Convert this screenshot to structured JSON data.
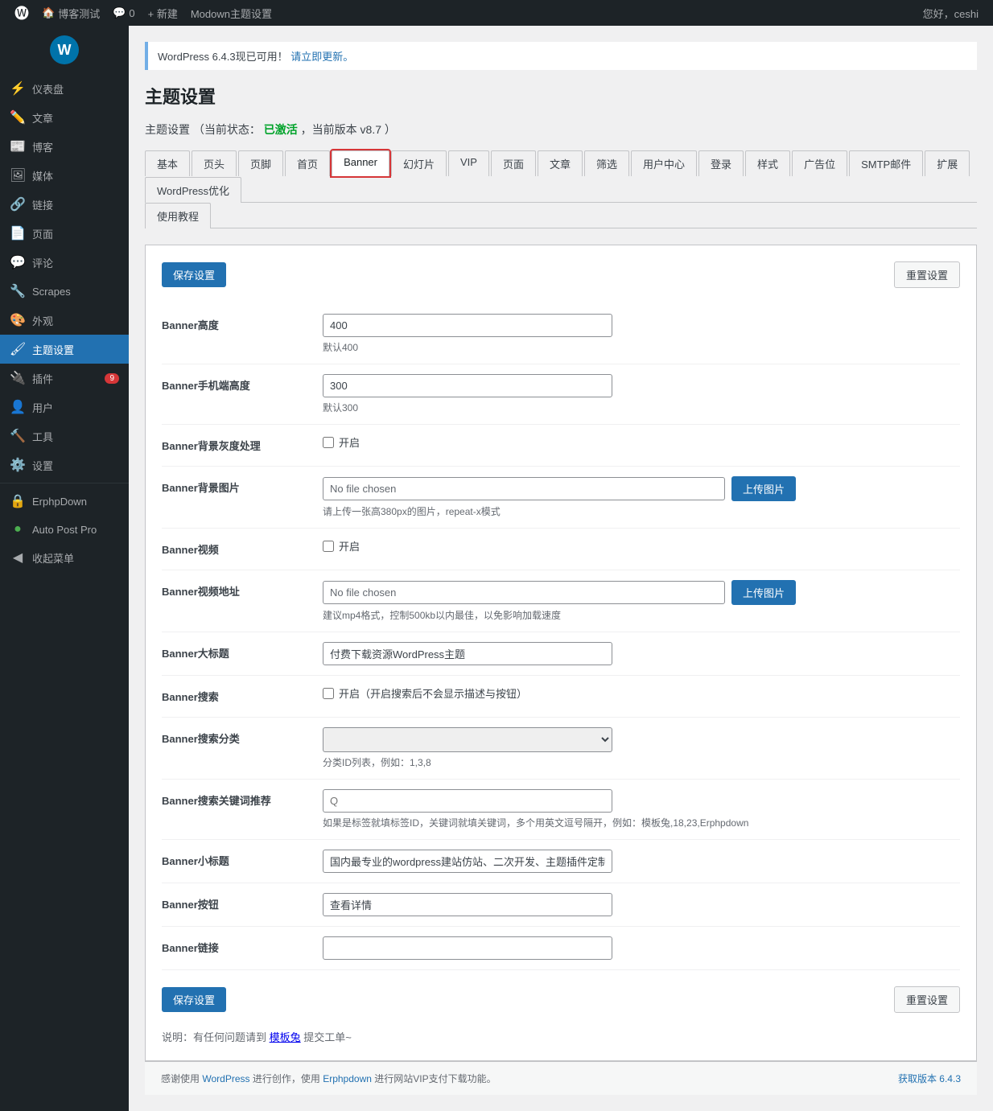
{
  "adminbar": {
    "site_name": "博客测试",
    "comment_count": "0",
    "new_label": "+ 新建",
    "page_title_bar": "Modown主题设置",
    "user_greeting": "您好，ceshi"
  },
  "sidebar": {
    "items": [
      {
        "id": "dashboard",
        "label": "仪表盘",
        "icon": "⚡"
      },
      {
        "id": "posts",
        "label": "文章",
        "icon": "✏️"
      },
      {
        "id": "blog",
        "label": "博客",
        "icon": "📰"
      },
      {
        "id": "media",
        "label": "媒体",
        "icon": "🖼"
      },
      {
        "id": "links",
        "label": "链接",
        "icon": "🔗"
      },
      {
        "id": "pages",
        "label": "页面",
        "icon": "📄"
      },
      {
        "id": "comments",
        "label": "评论",
        "icon": "💬"
      },
      {
        "id": "scrapes",
        "label": "Scrapes",
        "icon": "🔧"
      },
      {
        "id": "appearance",
        "label": "外观",
        "icon": "🎨"
      },
      {
        "id": "theme-settings",
        "label": "主题设置",
        "icon": "🖌",
        "active": true
      },
      {
        "id": "plugins",
        "label": "插件",
        "icon": "🔌",
        "badge": "9"
      },
      {
        "id": "users",
        "label": "用户",
        "icon": "👤"
      },
      {
        "id": "tools",
        "label": "工具",
        "icon": "🔨"
      },
      {
        "id": "settings",
        "label": "设置",
        "icon": "⚙️"
      },
      {
        "id": "erphpdown",
        "label": "ErphpDown",
        "icon": "🔒"
      },
      {
        "id": "autopostpro",
        "label": "Auto Post Pro",
        "icon": "●"
      },
      {
        "id": "cart",
        "label": "收起菜单",
        "icon": "◀"
      }
    ]
  },
  "update_notice": {
    "text": "WordPress 6.4.3现已可用！",
    "link_text": "请立即更新。",
    "link_url": "#"
  },
  "page_title": "主题设置",
  "theme_settings_header": {
    "label": "主题设置",
    "status_prefix": "（当前状态：",
    "status": "已激活",
    "status_suffix": "，当前版本 v8.7 ）"
  },
  "tabs_row1": [
    {
      "id": "basic",
      "label": "基本"
    },
    {
      "id": "header",
      "label": "页头"
    },
    {
      "id": "footer",
      "label": "页脚"
    },
    {
      "id": "home",
      "label": "首页"
    },
    {
      "id": "banner",
      "label": "Banner",
      "active": true,
      "highlighted": true
    },
    {
      "id": "slideshow",
      "label": "幻灯片"
    },
    {
      "id": "vip",
      "label": "VIP"
    },
    {
      "id": "pagepage",
      "label": "页面"
    },
    {
      "id": "article",
      "label": "文章"
    },
    {
      "id": "filter",
      "label": "筛选"
    },
    {
      "id": "usercenter",
      "label": "用户中心"
    },
    {
      "id": "login",
      "label": "登录"
    },
    {
      "id": "style",
      "label": "样式"
    },
    {
      "id": "advert",
      "label": "广告位"
    },
    {
      "id": "smtp",
      "label": "SMTP邮件"
    },
    {
      "id": "extend",
      "label": "扩展"
    },
    {
      "id": "wpopt",
      "label": "WordPress优化"
    }
  ],
  "tabs_row2": [
    {
      "id": "tutorial",
      "label": "使用教程"
    }
  ],
  "buttons": {
    "save_settings": "保存设置",
    "reset_settings": "重置设置",
    "upload_image": "上传图片"
  },
  "form_fields": [
    {
      "id": "banner-height",
      "label": "Banner高度",
      "type": "text",
      "value": "400",
      "description": "默认400"
    },
    {
      "id": "banner-mobile-height",
      "label": "Banner手机端高度",
      "type": "text",
      "value": "300",
      "description": "默认300"
    },
    {
      "id": "banner-bg-grayscale",
      "label": "Banner背景灰度处理",
      "type": "checkbox",
      "checked": false,
      "checkbox_label": "开启"
    },
    {
      "id": "banner-bg-image",
      "label": "Banner背景图片",
      "type": "file",
      "placeholder": "No file chosen",
      "description": "请上传一张高380px的图片，repeat-x模式"
    },
    {
      "id": "banner-video",
      "label": "Banner视频",
      "type": "checkbox",
      "checked": false,
      "checkbox_label": "开启"
    },
    {
      "id": "banner-video-url",
      "label": "Banner视频地址",
      "type": "file",
      "placeholder": "No file chosen",
      "description": "建议mp4格式，控制500kb以内最佳，以免影响加载速度"
    },
    {
      "id": "banner-title",
      "label": "Banner大标题",
      "type": "text",
      "value": "付费下载资源WordPress主题",
      "description": ""
    },
    {
      "id": "banner-search",
      "label": "Banner搜索",
      "type": "checkbox",
      "checked": false,
      "checkbox_label": "开启（开启搜索后不会显示描述与按钮）"
    },
    {
      "id": "banner-search-category",
      "label": "Banner搜索分类",
      "type": "select",
      "value": "",
      "description": "分类ID列表，例如：1,3,8"
    },
    {
      "id": "banner-search-keywords",
      "label": "Banner搜索关键词推荐",
      "type": "text",
      "value": "",
      "placeholder": "Q",
      "description": "如果是标签就填标签ID，关键词就填关键词，多个用英文逗号隔开，例如：模板兔,18,23,Erphpdown"
    },
    {
      "id": "banner-subtitle",
      "label": "Banner小标题",
      "type": "text",
      "value": "国内最专业的wordpress建站仿站、二次开发、主题插件定制服务商！",
      "description": ""
    },
    {
      "id": "banner-button",
      "label": "Banner按钮",
      "type": "text",
      "value": "查看详情",
      "description": ""
    },
    {
      "id": "banner-link",
      "label": "Banner链接",
      "type": "text",
      "value": "",
      "description": ""
    }
  ],
  "footer_note": {
    "prefix": "说明：有任何问题请到",
    "link_text": "模板兔",
    "suffix": "提交工单~"
  },
  "footer_bar": {
    "left_prefix": "感谢使用",
    "wp_link": "WordPress",
    "left_mid": "进行创作，使用",
    "erphp_link": "Erphpdown",
    "left_suffix": "进行网站VIP支付下载功能。",
    "right_link": "获取版本 6.4.3"
  }
}
